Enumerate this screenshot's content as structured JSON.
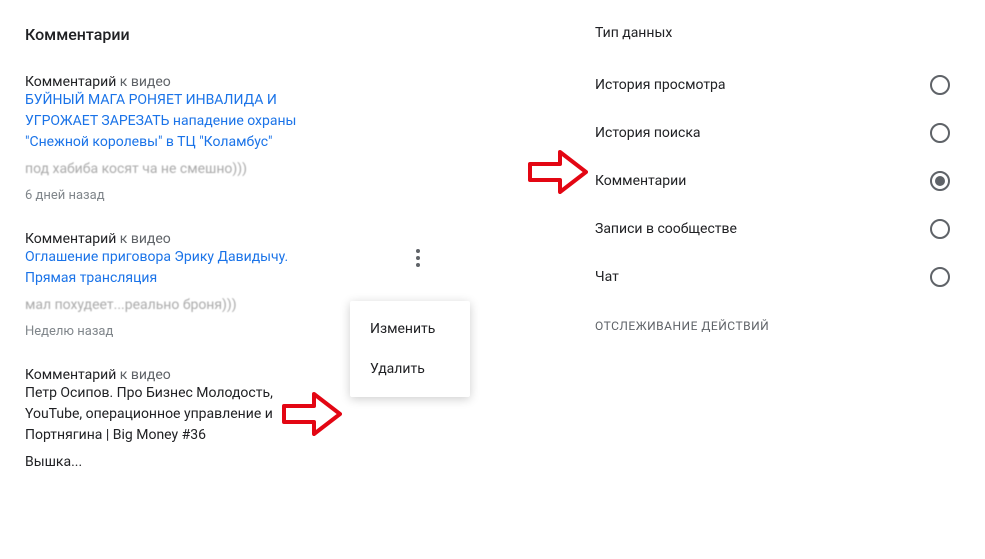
{
  "left": {
    "section_title": "Комментарии",
    "items": [
      {
        "label": "Комментарий",
        "label_suffix": " к видео",
        "video_title": "БУЙНЫЙ МАГА РОНЯЕТ ИНВАЛИДА И УГРОЖАЕТ ЗАРЕЗАТЬ нападение охраны \"Снежной королевы\" в ТЦ \"Коламбус\"",
        "body": "       под хабиба косят          ча   не       смешно)))",
        "time": "6 дней назад"
      },
      {
        "label": "Комментарий",
        "label_suffix": " к видео",
        "video_title": "Оглашение приговора Эрику Давидычу. Прямая трансляция",
        "body": "          мал     похудеет...реально броня)))",
        "time": "Неделю назад"
      },
      {
        "label": "Комментарий",
        "label_suffix": " к видео",
        "video_title": "Петр Осипов. Про Бизнес Молодость, YouTube, операционное управление и Портнягина | Big Money #36",
        "body": "Вышка...",
        "time": ""
      }
    ],
    "popup": {
      "edit": "Изменить",
      "delete": "Удалить"
    }
  },
  "right": {
    "data_type_title": "Тип данных",
    "options": [
      {
        "label": "История просмотра",
        "selected": false
      },
      {
        "label": "История поиска",
        "selected": false
      },
      {
        "label": "Комментарии",
        "selected": true
      },
      {
        "label": "Записи в сообществе",
        "selected": false
      },
      {
        "label": "Чат",
        "selected": false
      }
    ],
    "tracking_header": "ОТСЛЕЖИВАНИЕ ДЕЙСТВИЙ"
  }
}
